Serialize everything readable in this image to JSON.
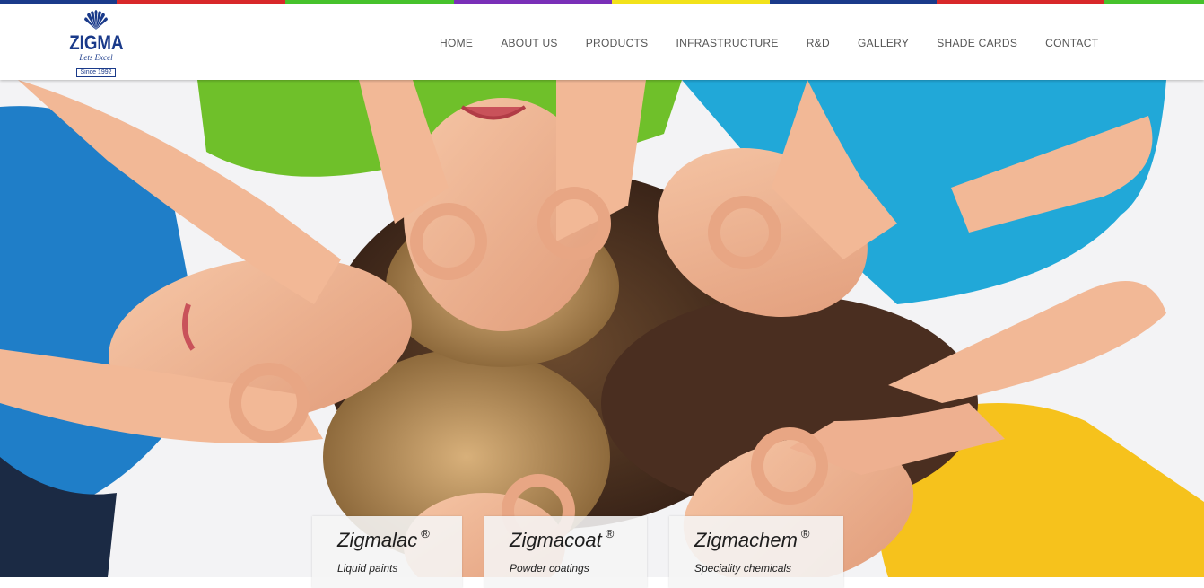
{
  "colors": {
    "brand": "#1a3a8a",
    "stripe": [
      "#1a3a8a",
      "#d8282a",
      "#46c22c",
      "#7a2fb8",
      "#f2e21a",
      "#1a3a8a",
      "#d8282a",
      "#46c22c"
    ]
  },
  "logo": {
    "icon": "shell-logo-icon",
    "name": "ZIGMA",
    "tagline": "Lets Excel",
    "since": "Since 1992"
  },
  "nav": {
    "items": [
      "HOME",
      "ABOUT US",
      "PRODUCTS",
      "INFRASTRUCTURE",
      "R&D",
      "GALLERY",
      "SHADE CARDS",
      "CONTACT"
    ]
  },
  "hero": {
    "image": "children-lying-in-circle-hero-photo"
  },
  "cards": [
    {
      "title": "Zigmalac",
      "mark": "®",
      "subtitle": "Liquid paints"
    },
    {
      "title": "Zigmacoat",
      "mark": "®",
      "subtitle": "Powder coatings"
    },
    {
      "title": "Zigmachem",
      "mark": "®",
      "subtitle": "Speciality chemicals"
    }
  ]
}
